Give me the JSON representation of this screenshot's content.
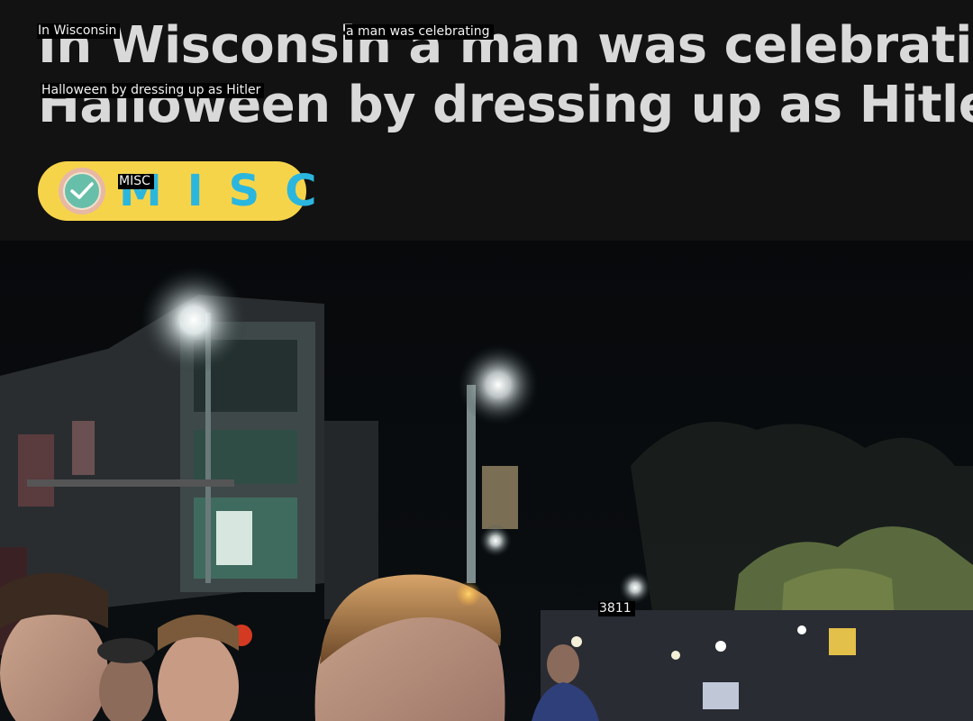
{
  "article": {
    "headline_line1": "In Wisconsin a man was celebrating",
    "headline_line2": "Halloween by dressing up as Hitler",
    "category_badge": {
      "label": "MISC",
      "icon": "checkmark-badge-icon",
      "background_color": "#f6d44a",
      "text_color": "#2bb6de"
    },
    "photo": {
      "description_icon": "street-night-photo"
    }
  },
  "overlay_labels": {
    "label_1": "In Wisconsin",
    "label_2": "a man was celebrating",
    "label_3": "Halloween by dressing up as Hitler",
    "label_4": "MISC",
    "label_5": "3811"
  }
}
